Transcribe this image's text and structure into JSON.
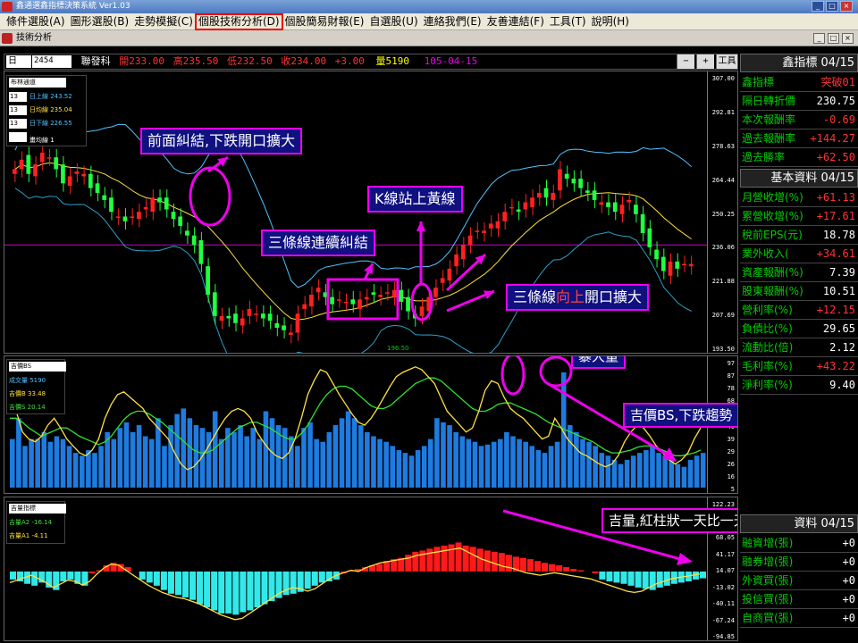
{
  "window": {
    "title": "鑫通選鑫指標決策系統 Ver1.03"
  },
  "menu": [
    {
      "label": "條件選股(A)",
      "selected": false
    },
    {
      "label": "圖形選股(B)",
      "selected": false
    },
    {
      "label": "走勢模擬(C)",
      "selected": false
    },
    {
      "label": "個股技術分析(D)",
      "selected": true
    },
    {
      "label": "個股簡易財報(E)",
      "selected": false
    },
    {
      "label": "自選股(U)",
      "selected": false
    },
    {
      "label": "連絡我們(E)",
      "selected": false
    },
    {
      "label": "友善連結(F)",
      "selected": false
    },
    {
      "label": "工具(T)",
      "selected": false
    },
    {
      "label": "說明(H)",
      "selected": false
    }
  ],
  "subwindow": {
    "title": "技術分析"
  },
  "quote": {
    "period": "日",
    "code": "2454",
    "name": "聯發科",
    "open_label": "開",
    "open": "233.00",
    "high_label": "高",
    "high": "235.50",
    "low_label": "低",
    "low": "232.50",
    "close_label": "收",
    "close": "234.00",
    "change": "+3.00",
    "vol_label": "量",
    "vol": "5190",
    "date": "105-04-15",
    "minus": "−",
    "plus": "+",
    "tools": "工具"
  },
  "price_panel": {
    "legend": {
      "title": "布林通道",
      "rows": [
        {
          "n": "13",
          "label": "日上線 243.52",
          "color": "#4fc3ff"
        },
        {
          "n": "13",
          "label": "日均線 235.04",
          "color": "#ffe040"
        },
        {
          "n": "13",
          "label": "日下線 226.55",
          "color": "#4fc3ff"
        },
        {
          "n": "",
          "label": "畫均線 1",
          "color": "#ffffff"
        }
      ]
    },
    "yticks": [
      "307.00",
      "292.81",
      "278.63",
      "264.44",
      "250.25",
      "236.06",
      "221.88",
      "207.69",
      "193.50"
    ],
    "low_mark": "196.50",
    "annotations": [
      "前面糾結,下跌開口擴大",
      "三條線連續糾結",
      "K線站上黃線",
      "三條線向上開口擴大"
    ],
    "annot4_parts": [
      "三條線",
      "向上",
      "開口擴大"
    ]
  },
  "bs_panel": {
    "legend": {
      "title": "吉價BS",
      "rows": [
        {
          "label": "成交量 5190",
          "color": "#4fc3ff"
        },
        {
          "label": "吉價B 33.48",
          "color": "#ffe040"
        },
        {
          "label": "吉價S 20.14",
          "color": "#40e040"
        }
      ]
    },
    "yticks": [
      "97",
      "87",
      "78",
      "68",
      "58",
      "49",
      "39",
      "29",
      "26",
      "16",
      "5"
    ],
    "annotations": [
      "暴大量",
      "吉價BS,下跌趨勢"
    ]
  },
  "vol_panel": {
    "legend": {
      "title": "吉量指標",
      "rows": [
        {
          "label": "吉量A2 -16.14",
          "color": "#40e040"
        },
        {
          "label": "吉量A1 -4.11",
          "color": "#ffe040"
        }
      ]
    },
    "yticks": [
      "122.23",
      "95.14",
      "68.05",
      "41.17",
      "14.07",
      "-13.02",
      "-40.11",
      "-67.24",
      "-94.85"
    ],
    "annotations": [
      "吉量,紅柱狀一天比一天短"
    ]
  },
  "right_panel": {
    "sections": [
      {
        "title": "鑫指標 04/15",
        "rows": [
          {
            "k": "鑫指標",
            "v": "突破01",
            "c": "red"
          },
          {
            "k": "隔日轉折價",
            "v": "230.75",
            "c": "white"
          },
          {
            "k": "本次報酬率",
            "v": "-0.69",
            "c": "red"
          },
          {
            "k": "過去報酬率",
            "v": "+144.27",
            "c": "red"
          },
          {
            "k": "過去勝率",
            "v": "+62.50",
            "c": "red"
          }
        ]
      },
      {
        "title": "基本資料 04/15",
        "rows": [
          {
            "k": "月營收增(%)",
            "v": "+61.13",
            "c": "red"
          },
          {
            "k": "累營收增(%)",
            "v": "+17.61",
            "c": "red"
          },
          {
            "k": "稅前EPS(元)",
            "v": "18.78",
            "c": "white"
          },
          {
            "k": "業外收入(",
            "v": "+34.61",
            "c": "red"
          },
          {
            "k": "資產報酬(%)",
            "v": "7.39",
            "c": "white"
          },
          {
            "k": "股東報酬(%)",
            "v": "10.51",
            "c": "white"
          },
          {
            "k": "營利率(%)",
            "v": "+12.15",
            "c": "red"
          },
          {
            "k": "負債比(%)",
            "v": "29.65",
            "c": "white"
          },
          {
            "k": "流動比(倍)",
            "v": "2.12",
            "c": "white"
          },
          {
            "k": "毛利率(%)",
            "v": "+43.22",
            "c": "red"
          },
          {
            "k": "淨利率(%)",
            "v": "9.40",
            "c": "white"
          }
        ]
      },
      {
        "title": "資料 04/15",
        "rows": [
          {
            "k": "融資增(張)",
            "v": "+0",
            "c": "white"
          },
          {
            "k": "融券增(張)",
            "v": "+0",
            "c": "white"
          },
          {
            "k": "外資買(張)",
            "v": "+0",
            "c": "white"
          },
          {
            "k": "投信買(張)",
            "v": "+0",
            "c": "white"
          },
          {
            "k": "自商買(張)",
            "v": "+0",
            "c": "white"
          }
        ]
      }
    ]
  },
  "chart_data": [
    {
      "type": "candlestick",
      "title": "布林通道",
      "ylim": [
        193.5,
        307
      ],
      "series_close": [
        268,
        272,
        266,
        270,
        275,
        273,
        268,
        262,
        265,
        267,
        266,
        260,
        258,
        255,
        250,
        248,
        246,
        248,
        250,
        252,
        256,
        254,
        251,
        247,
        244,
        240,
        236,
        228,
        215,
        206,
        206,
        205,
        203,
        205,
        209,
        207,
        205,
        204,
        201,
        200,
        199,
        207,
        211,
        215,
        218,
        214,
        211,
        213,
        212,
        211,
        213,
        214,
        215,
        215,
        216,
        217,
        212,
        208,
        205,
        210,
        214,
        218,
        222,
        226,
        232,
        236,
        240,
        242,
        242,
        245,
        246,
        250,
        252,
        250,
        254,
        256,
        258,
        256,
        258,
        268,
        264,
        262,
        260,
        258,
        255,
        254,
        252,
        250,
        253,
        255,
        249,
        241,
        235,
        230,
        225,
        229,
        226,
        228,
        228
      ]
    },
    {
      "type": "bar",
      "title": "吉價BS",
      "ylim": [
        5,
        97
      ],
      "volume": [
        40,
        55,
        35,
        40,
        40,
        45,
        38,
        42,
        40,
        35,
        30,
        28,
        32,
        30,
        35,
        45,
        40,
        48,
        52,
        45,
        50,
        42,
        40,
        55,
        35,
        50,
        58,
        62,
        55,
        50,
        48,
        45,
        60,
        40,
        48,
        45,
        50,
        42,
        48,
        40,
        60,
        55,
        50,
        48,
        42,
        35,
        48,
        52,
        40,
        38,
        45,
        50,
        55,
        60,
        55,
        50,
        45,
        42,
        40,
        38,
        35,
        32,
        30,
        28,
        32,
        35,
        40,
        55,
        52,
        50,
        45,
        42,
        40,
        38,
        35,
        36,
        38,
        40,
        45,
        42,
        40,
        38,
        35,
        32,
        30,
        35,
        38,
        88,
        50,
        45,
        40,
        38,
        35,
        30,
        28,
        25,
        22,
        25,
        28,
        30,
        32,
        35,
        30,
        28,
        25,
        22,
        20,
        25,
        28,
        30
      ],
      "B": [
        70,
        60,
        45,
        40,
        38,
        42,
        50,
        55,
        48,
        40,
        35,
        30,
        28,
        32,
        40,
        55,
        65,
        72,
        74,
        70,
        66,
        62,
        55,
        50,
        45,
        40,
        30,
        22,
        18,
        20,
        25,
        32,
        40,
        48,
        55,
        60,
        62,
        60,
        55,
        45,
        38,
        32,
        28,
        26,
        30,
        40,
        55,
        72,
        82,
        90,
        88,
        80,
        72,
        65,
        58,
        52,
        50,
        55,
        62,
        70,
        78,
        85,
        88,
        90,
        92,
        90,
        85,
        80,
        70,
        60,
        55,
        50,
        45,
        48,
        60,
        75,
        82,
        80,
        70,
        62,
        58,
        55,
        50,
        45,
        40,
        42,
        55,
        48,
        40,
        35,
        30,
        28,
        25,
        22,
        20,
        22,
        28,
        38,
        45,
        50,
        48,
        42,
        35,
        30,
        25,
        22,
        25,
        30,
        40,
        48
      ],
      "S": [
        55,
        55,
        52,
        48,
        45,
        42,
        44,
        46,
        48,
        48,
        45,
        42,
        40,
        38,
        36,
        38,
        42,
        48,
        54,
        58,
        60,
        60,
        58,
        55,
        52,
        48,
        44,
        40,
        36,
        32,
        30,
        30,
        32,
        36,
        40,
        44,
        48,
        50,
        52,
        52,
        50,
        48,
        45,
        42,
        40,
        40,
        44,
        50,
        58,
        66,
        72,
        76,
        78,
        78,
        76,
        72,
        68,
        64,
        62,
        62,
        64,
        68,
        72,
        76,
        80,
        82,
        84,
        84,
        82,
        78,
        74,
        70,
        66,
        62,
        60,
        60,
        62,
        65,
        66,
        66,
        64,
        62,
        60,
        58,
        55,
        52,
        50,
        48,
        46,
        44,
        42,
        40,
        38,
        35,
        32,
        30,
        30,
        31,
        32,
        34,
        35,
        35,
        34,
        32,
        30,
        28,
        28,
        29,
        30,
        32
      ]
    },
    {
      "type": "bar",
      "title": "吉量指標",
      "ylim": [
        -94.85,
        122.23
      ],
      "A": [
        -5,
        -8,
        -12,
        -15,
        -10,
        -18,
        -22,
        -8,
        -5,
        -12,
        -15,
        5,
        10,
        18,
        22,
        20,
        15,
        8,
        -5,
        -10,
        -15,
        -22,
        -28,
        -30,
        -34,
        -38,
        -45,
        -50,
        -55,
        -60,
        -60,
        -62,
        -58,
        -55,
        -50,
        -45,
        -40,
        -35,
        -30,
        -28,
        -25,
        -20,
        -15,
        -10,
        -8,
        -5,
        5,
        10,
        12,
        15,
        18,
        20,
        25,
        28,
        30,
        35,
        40,
        42,
        45,
        48,
        50,
        52,
        55,
        50,
        48,
        45,
        42,
        40,
        38,
        35,
        32,
        30,
        28,
        25,
        22,
        20,
        18,
        15,
        12,
        10,
        8,
        5,
        -5,
        -8,
        -10,
        -12,
        -15,
        -18,
        -20,
        -22,
        -18,
        -15,
        -12,
        -10,
        -8,
        -5,
        -3
      ],
      "A1": [
        -10,
        -6,
        -2,
        2,
        -4,
        -10,
        -18,
        -12,
        -6,
        -8,
        -14,
        -8,
        4,
        14,
        20,
        18,
        10,
        2,
        -6,
        -14,
        -20,
        -26,
        -30,
        -34,
        -36,
        -40,
        -44,
        -50,
        -56,
        -62,
        -66,
        -70,
        -68,
        -60,
        -52,
        -44,
        -36,
        -28,
        -22,
        -18,
        -20,
        -24,
        -20,
        -12,
        -4,
        2,
        6,
        10,
        8,
        14,
        18,
        22,
        24,
        26,
        28,
        30,
        34,
        36,
        38,
        40,
        42,
        44,
        46,
        40,
        34,
        28,
        24,
        20,
        16,
        14,
        10,
        6,
        4,
        2,
        4,
        6,
        4,
        2,
        0,
        -2,
        -4,
        -8,
        -12,
        -16,
        -20,
        -24,
        -26,
        -24,
        -18,
        -12,
        -8,
        -4,
        -2,
        0,
        2,
        4
      ]
    }
  ]
}
